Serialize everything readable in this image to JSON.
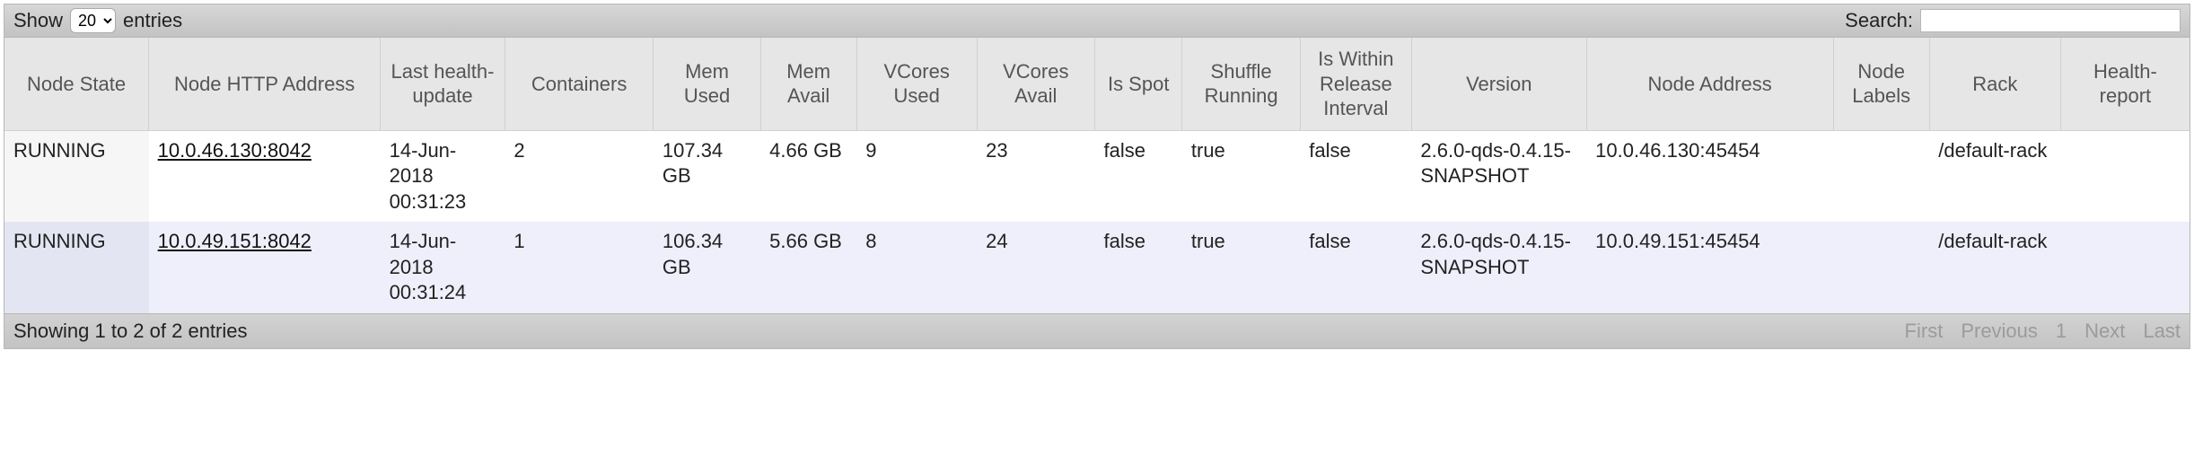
{
  "topbar": {
    "show_label": "Show",
    "entries_label": "entries",
    "entries_value": "20",
    "search_label": "Search:"
  },
  "columns": [
    "Node State",
    "Node HTTP Address",
    "Last health-update",
    "Containers",
    "Mem Used",
    "Mem Avail",
    "VCores Used",
    "VCores Avail",
    "Is Spot",
    "Shuffle Running",
    "Is Within Release Interval",
    "Version",
    "Node Address",
    "Node Labels",
    "Rack",
    "Health-report"
  ],
  "rows": [
    {
      "state": "RUNNING",
      "http": "10.0.46.130:8042",
      "health": "14-Jun-2018 00:31:23",
      "containers": "2",
      "mem_used": "107.34 GB",
      "mem_avail": "4.66 GB",
      "vc_used": "9",
      "vc_avail": "23",
      "is_spot": "false",
      "shuffle": "true",
      "within": "false",
      "version": "2.6.0-qds-0.4.15-SNAPSHOT",
      "address": "10.0.46.130:45454",
      "labels": "",
      "rack": "/default-rack",
      "report": ""
    },
    {
      "state": "RUNNING",
      "http": "10.0.49.151:8042",
      "health": "14-Jun-2018 00:31:24",
      "containers": "1",
      "mem_used": "106.34 GB",
      "mem_avail": "5.66 GB",
      "vc_used": "8",
      "vc_avail": "24",
      "is_spot": "false",
      "shuffle": "true",
      "within": "false",
      "version": "2.6.0-qds-0.4.15-SNAPSHOT",
      "address": "10.0.49.151:45454",
      "labels": "",
      "rack": "/default-rack",
      "report": ""
    }
  ],
  "botbar": {
    "info": "Showing 1 to 2 of 2 entries",
    "first": "First",
    "previous": "Previous",
    "page": "1",
    "next": "Next",
    "last": "Last"
  }
}
